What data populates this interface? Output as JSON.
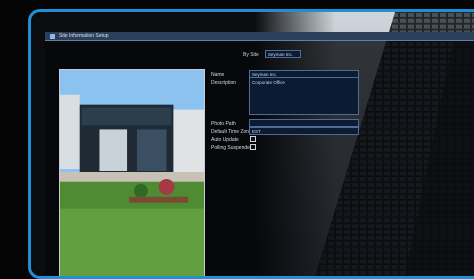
{
  "window": {
    "title": "Site Information Setup"
  },
  "site": {
    "label": "By Site",
    "selected": "Seyman Inc."
  },
  "fields": {
    "name_label": "Name",
    "name_value": "Seyman Inc.",
    "description_label": "Description",
    "description_value": "Corporate Office",
    "photo_path_label": "Photo Path",
    "time_zone_label": "Default Time Zone",
    "time_zone_value": "EST",
    "auto_update_label": "Auto Update",
    "polling_suspended_label": "Polling Suspended"
  },
  "colors": {
    "accent_border": "#1f8fd6",
    "titlebar": "#2b3f5a",
    "input_bg": "#0b1b33"
  }
}
